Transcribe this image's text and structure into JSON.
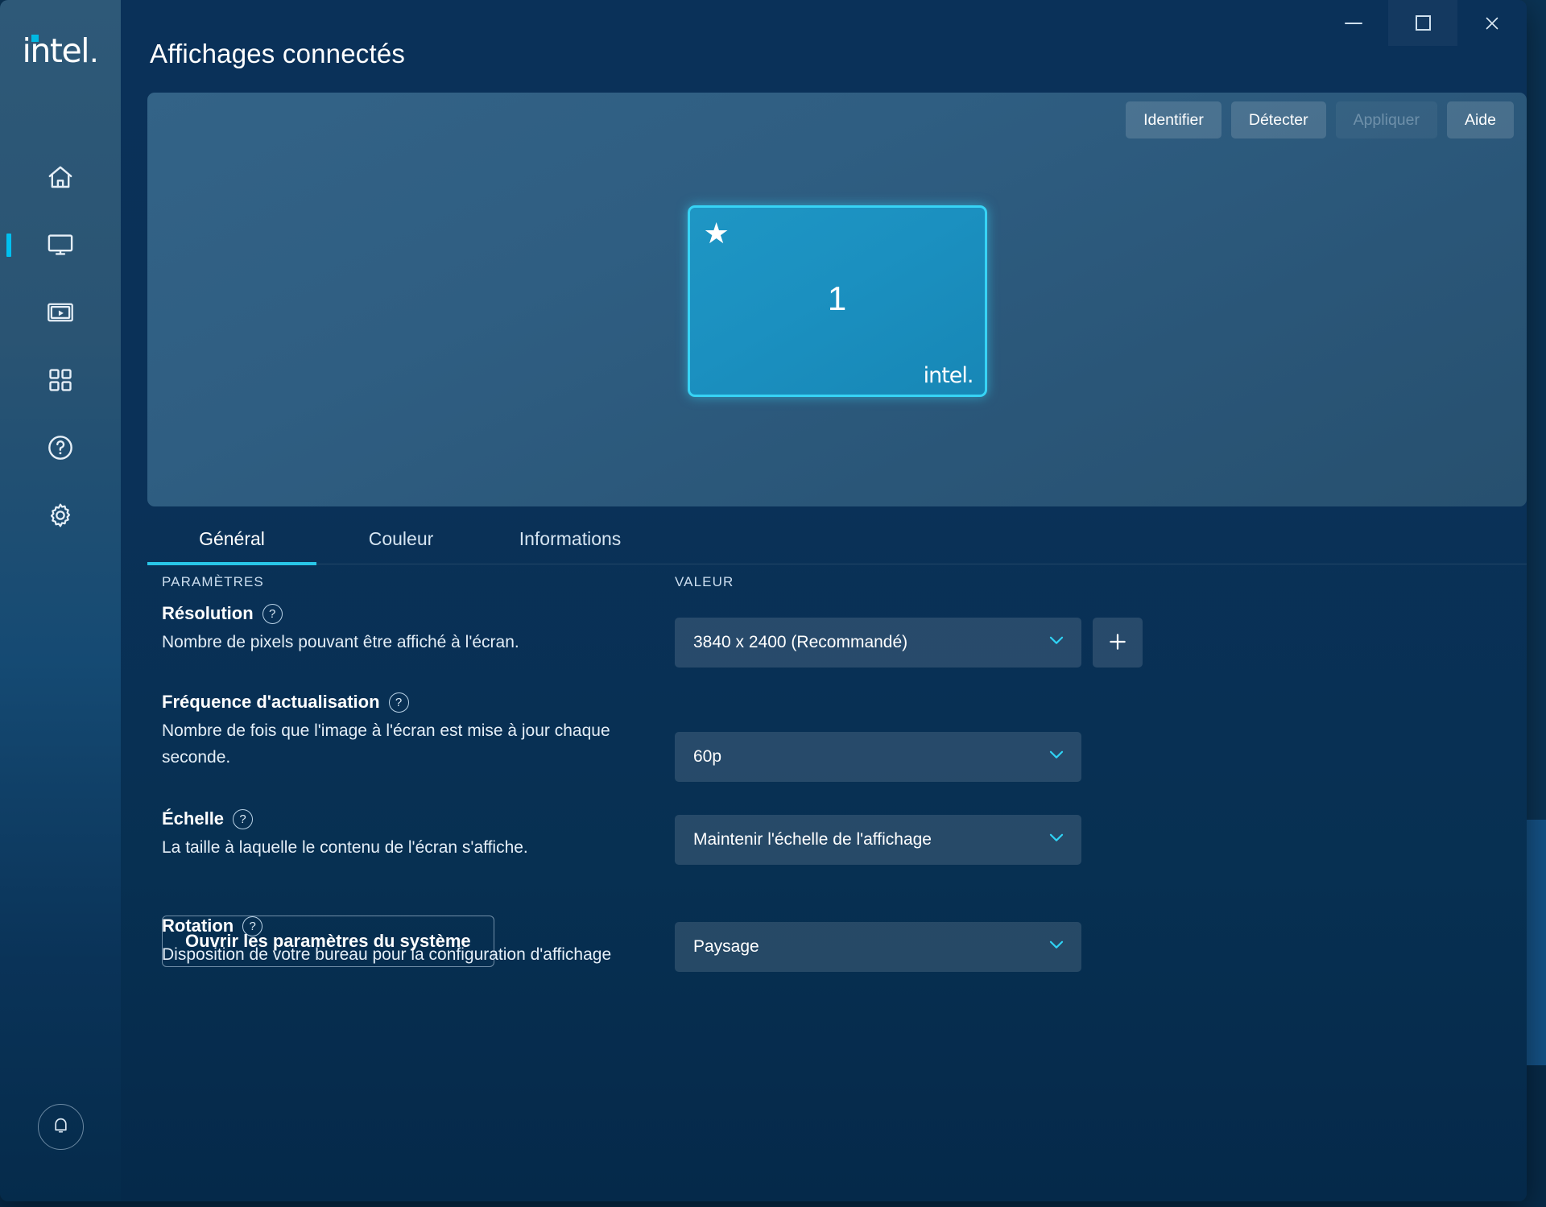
{
  "window": {
    "title": "Affichages connectés",
    "controls": {
      "minimize": "minimize-icon",
      "maximize": "maximize-icon",
      "close": "✕"
    }
  },
  "sidebar": {
    "brand": "intel",
    "brand_period": ".",
    "items": [
      {
        "name": "home",
        "label": "Accueil",
        "icon": "home-icon",
        "active": false
      },
      {
        "name": "display",
        "label": "Affichage",
        "icon": "display-icon",
        "active": true
      },
      {
        "name": "video",
        "label": "Vidéo",
        "icon": "video-icon",
        "active": false
      },
      {
        "name": "apps",
        "label": "Jeux",
        "icon": "grid-icon",
        "active": false
      },
      {
        "name": "support",
        "label": "Support",
        "icon": "help-circle-icon",
        "active": false
      },
      {
        "name": "system",
        "label": "Système",
        "icon": "gear-icon",
        "active": false
      }
    ],
    "notifications": {
      "icon": "bell-icon",
      "label": "Notifications"
    }
  },
  "preview": {
    "buttons": [
      {
        "label": "Identifier",
        "disabled": false
      },
      {
        "label": "Détecter",
        "disabled": false
      },
      {
        "label": "Appliquer",
        "disabled": true
      },
      {
        "label": "Aide",
        "disabled": false
      }
    ],
    "monitor": {
      "number": "1",
      "primary_icon": "★",
      "brand": "intel",
      "brand_period": "."
    }
  },
  "tabs": [
    {
      "label": "Général",
      "active": true
    },
    {
      "label": "Couleur",
      "active": false
    },
    {
      "label": "Informations",
      "active": false
    }
  ],
  "table": {
    "headers": {
      "params": "PARAMÈTRES",
      "value": "VALEUR"
    },
    "rows": [
      {
        "title": "Résolution",
        "help": "?",
        "desc": "Nombre de pixels pouvant être affiché à l'écran.",
        "value": "3840 x 2400 (Recommandé)",
        "has_add": true
      },
      {
        "title": "Fréquence d'actualisation",
        "help": "?",
        "desc": "Nombre de fois que l'image à l'écran est mise à jour chaque seconde.",
        "value": "60p",
        "has_add": false
      },
      {
        "title": "Échelle",
        "help": "?",
        "desc": "La taille à laquelle le contenu de l'écran s'affiche.",
        "value": "Maintenir l'échelle de l'affichage",
        "has_add": false
      },
      {
        "title": "Rotation",
        "help": "?",
        "desc": "Disposition de votre bureau pour la configuration d'affichage",
        "value": "Paysage",
        "has_add": false
      }
    ]
  },
  "footer": {
    "system_settings_label": "Ouvrir les paramètres du système"
  },
  "colors": {
    "accent_cyan": "#29c6e8",
    "brand_dot": "#00b9e4",
    "monitor_fill": "#1b90c0",
    "monitor_border": "#37d3f5",
    "window_bg": "#0a3159"
  }
}
